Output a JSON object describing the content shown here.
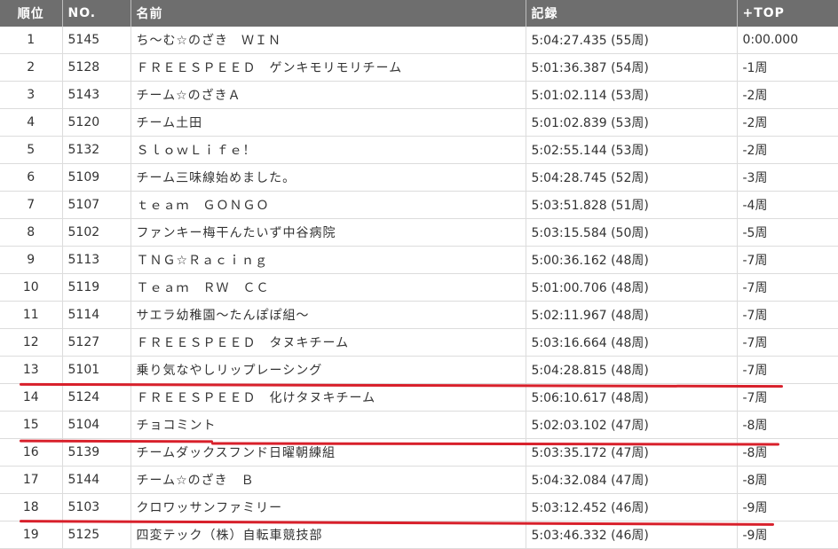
{
  "table": {
    "headers": {
      "rank": "順位",
      "no": "NO.",
      "name": "名前",
      "record": "記録",
      "top": "+TOP"
    },
    "rows": [
      {
        "rank": "1",
        "no": "5145",
        "name": "ち～む☆のざき　ＷＩＮ",
        "record": "5:04:27.435 (55周)",
        "top": "0:00.000"
      },
      {
        "rank": "2",
        "no": "5128",
        "name": "ＦＲＥＥＳＰＥＥＤ　ゲンキモリモリチーム",
        "record": "5:01:36.387 (54周)",
        "top": "-1周"
      },
      {
        "rank": "3",
        "no": "5143",
        "name": "チーム☆のざきＡ",
        "record": "5:01:02.114 (53周)",
        "top": "-2周"
      },
      {
        "rank": "4",
        "no": "5120",
        "name": "チーム土田",
        "record": "5:01:02.839 (53周)",
        "top": "-2周"
      },
      {
        "rank": "5",
        "no": "5132",
        "name": "ＳｌｏｗＬｉｆｅ！",
        "record": "5:02:55.144 (53周)",
        "top": "-2周"
      },
      {
        "rank": "6",
        "no": "5109",
        "name": "チーム三味線始めました。",
        "record": "5:04:28.745 (52周)",
        "top": "-3周"
      },
      {
        "rank": "7",
        "no": "5107",
        "name": "ｔｅａｍ　ＧＯＮＧＯ",
        "record": "5:03:51.828 (51周)",
        "top": "-4周"
      },
      {
        "rank": "8",
        "no": "5102",
        "name": "ファンキー梅干んたいず中谷病院",
        "record": "5:03:15.584 (50周)",
        "top": "-5周"
      },
      {
        "rank": "9",
        "no": "5113",
        "name": "ＴＮＧ☆Ｒａｃｉｎｇ",
        "record": "5:00:36.162 (48周)",
        "top": "-7周"
      },
      {
        "rank": "10",
        "no": "5119",
        "name": "Ｔｅａｍ　ＲＷ　ＣＣ",
        "record": "5:01:00.706 (48周)",
        "top": "-7周"
      },
      {
        "rank": "11",
        "no": "5114",
        "name": "サエラ幼稚園～たんぽぽ組～",
        "record": "5:02:11.967 (48周)",
        "top": "-7周"
      },
      {
        "rank": "12",
        "no": "5127",
        "name": "ＦＲＥＥＳＰＥＥＤ　タヌキチーム",
        "record": "5:03:16.664 (48周)",
        "top": "-7周"
      },
      {
        "rank": "13",
        "no": "5101",
        "name": "乗り気なやしリップレーシング",
        "record": "5:04:28.815 (48周)",
        "top": "-7周"
      },
      {
        "rank": "14",
        "no": "5124",
        "name": "ＦＲＥＥＳＰＥＥＤ　化けタヌキチーム",
        "record": "5:06:10.617 (48周)",
        "top": "-7周"
      },
      {
        "rank": "15",
        "no": "5104",
        "name": "チョコミント",
        "record": "5:02:03.102 (47周)",
        "top": "-8周"
      },
      {
        "rank": "16",
        "no": "5139",
        "name": "チームダックスフンド日曜朝練組",
        "record": "5:03:35.172 (47周)",
        "top": "-8周"
      },
      {
        "rank": "17",
        "no": "5144",
        "name": "チーム☆のざき　Ｂ",
        "record": "5:04:32.084 (47周)",
        "top": "-8周"
      },
      {
        "rank": "18",
        "no": "5103",
        "name": "クロワッサンファミリー",
        "record": "5:03:12.452 (46周)",
        "top": "-9周"
      },
      {
        "rank": "19",
        "no": "5125",
        "name": "四変テック（株）自転車競技部",
        "record": "5:03:46.332 (46周)",
        "top": "-9周"
      }
    ]
  },
  "highlight_color": "#d8202b"
}
